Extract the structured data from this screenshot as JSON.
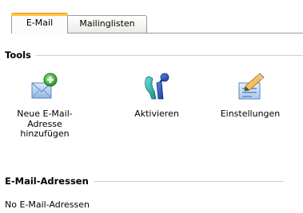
{
  "tabs": [
    {
      "label": "E-Mail",
      "active": true
    },
    {
      "label": "Mailinglisten",
      "active": false
    }
  ],
  "tools_section": {
    "heading": "Tools",
    "items": [
      {
        "label": "Neue E-Mail-\nAdresse\nhinzufügen",
        "icon": "envelope-add-icon"
      },
      {
        "label": "Aktivieren",
        "icon": "activate-figure-icon"
      },
      {
        "label": "Einstellungen",
        "icon": "settings-pen-icon"
      }
    ]
  },
  "addresses_section": {
    "heading": "E-Mail-Adressen",
    "empty_text": "No E-Mail-Adressen"
  },
  "colors": {
    "active_tab_accent": "#ffc83c",
    "tab_border": "#919b9c",
    "rule": "#d0d0bf"
  }
}
